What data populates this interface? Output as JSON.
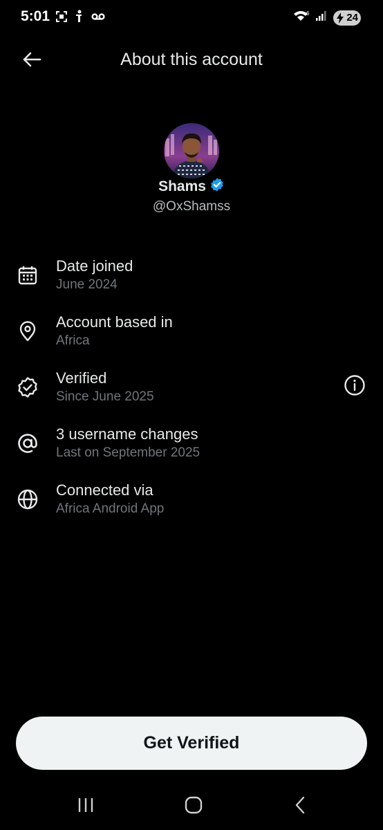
{
  "status_bar": {
    "time": "5:01",
    "battery_level": "24",
    "left_icons": [
      "screenshot-icon",
      "notification-icon",
      "voicemail-icon"
    ],
    "right_icons": [
      "wifi-icon",
      "signal-icon",
      "battery-icon"
    ]
  },
  "header": {
    "title": "About this account",
    "back_icon": "arrow-left-icon"
  },
  "profile": {
    "name": "Shams",
    "handle": "@OxShamss",
    "verified_badge_color": "#1d9bf0"
  },
  "info_items": [
    {
      "icon": "calendar-icon",
      "title": "Date joined",
      "subtitle": "June 2024"
    },
    {
      "icon": "location-pin-icon",
      "title": "Account based in",
      "subtitle": "Africa"
    },
    {
      "icon": "verified-badge-icon",
      "title": "Verified",
      "subtitle": "Since June 2025",
      "has_info_button": true
    },
    {
      "icon": "at-sign-icon",
      "title": "3 username changes",
      "subtitle": "Last on September 2025"
    },
    {
      "icon": "globe-icon",
      "title": "Connected via",
      "subtitle": "Africa Android App"
    }
  ],
  "cta": {
    "label": "Get Verified"
  },
  "nav_bar": {
    "items": [
      "recent-apps-icon",
      "home-icon",
      "back-icon"
    ]
  },
  "colors": {
    "background": "#000000",
    "primary_text": "#e7e9ea",
    "secondary_text": "#71767b",
    "button_bg": "#eff3f4",
    "button_text": "#0f1419",
    "accent": "#1d9bf0"
  }
}
